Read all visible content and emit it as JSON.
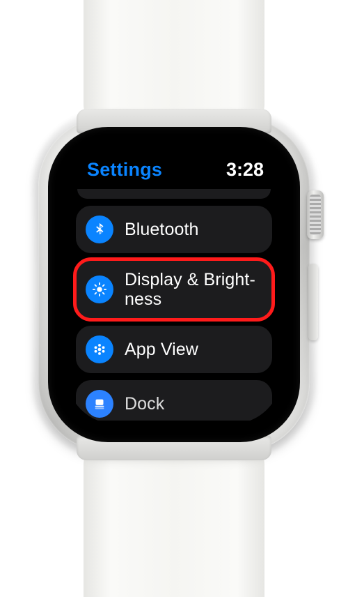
{
  "status": {
    "title": "Settings",
    "time": "3:28"
  },
  "rows": {
    "bluetooth": {
      "label": "Bluetooth"
    },
    "display": {
      "label": "Display & Bright­ness"
    },
    "appview": {
      "label": "App View"
    },
    "dock": {
      "label": "Dock"
    }
  },
  "colors": {
    "accent": "#0a84ff",
    "highlight": "#ff1b1b",
    "row_bg": "#1c1c1e"
  }
}
